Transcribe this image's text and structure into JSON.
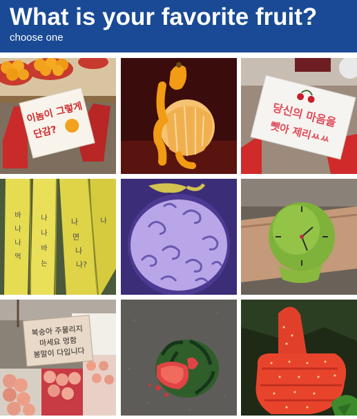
{
  "header": {
    "title": "What is your favorite fruit?",
    "subtitle": "choose one"
  },
  "colors": {
    "header_bg": "#1a4a96",
    "header_text": "#ffffff"
  },
  "tiles": [
    {
      "id": "oranges-sign",
      "sign_line1": "이놈이 그렇게",
      "sign_line2": "단감?"
    },
    {
      "id": "peeled-orange-figure"
    },
    {
      "id": "cherries-sign",
      "sign_line1": "당신의 마음을",
      "sign_line2": "뺏아 제리ㅆㅆ"
    },
    {
      "id": "bananas-writing",
      "words": [
        "바",
        "나",
        "나",
        "나",
        "나",
        "바",
        "먹",
        "나",
        "나",
        "면",
        "나",
        "는",
        "나?"
      ]
    },
    {
      "id": "devil-fruit"
    },
    {
      "id": "apple-watch"
    },
    {
      "id": "peaches-sign",
      "sign_line1": "복숭아 주물리지",
      "sign_line2": "마세요 멍함",
      "sign_line3": "봉말이 다입니다"
    },
    {
      "id": "smashed-watermelon"
    },
    {
      "id": "strawberry-thumbs-up"
    }
  ]
}
